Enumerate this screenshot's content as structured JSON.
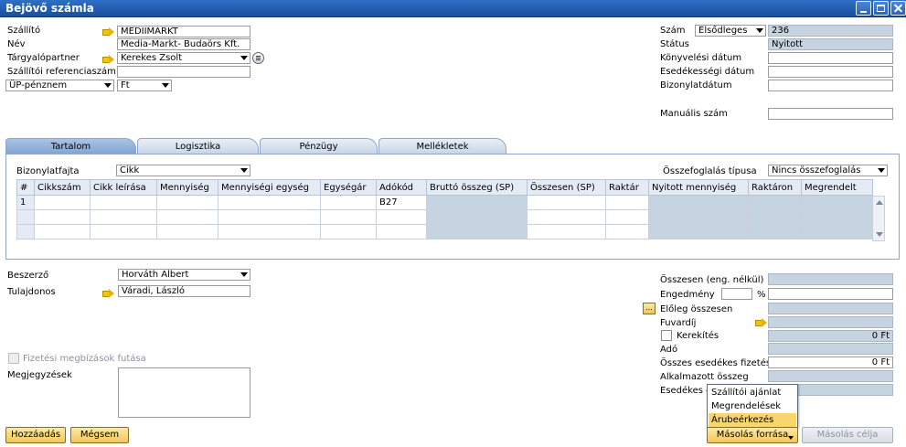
{
  "window": {
    "title": "Bejövő számla"
  },
  "header_left": {
    "supplier_label": "Szállító",
    "supplier_value": "MEDIIMARKT",
    "name_label": "Név",
    "name_value": "Media-Markt- Budaörs Kft.",
    "contact_label": "Tárgyalópartner",
    "contact_value": "Kerekes Zsolt",
    "ref_label": "Szállítói referenciaszám",
    "ref_value": "",
    "currency_type": "ÜP-pénznem",
    "currency": "Ft"
  },
  "header_right": {
    "number_label": "Szám",
    "series": "Elsődleges",
    "number_value": "236",
    "status_label": "Státus",
    "status_value": "Nyitott",
    "posting_label": "Könyvelési dátum",
    "due_label": "Esedékességi dátum",
    "doc_date_label": "Bizonylatdátum",
    "manual_label": "Manuális szám"
  },
  "tabs": [
    "Tartalom",
    "Logisztika",
    "Pénzügy",
    "Mellékletek"
  ],
  "content": {
    "doc_type_label": "Bizonylatfajta",
    "doc_type_value": "Cikk",
    "summary_label": "Összefoglalás típusa",
    "summary_value": "Nincs összefoglalás",
    "columns": [
      "#",
      "Cikkszám",
      "Cikk leírása",
      "Mennyiség",
      "Mennyiségi egység",
      "Egységár",
      "Adókód",
      "Bruttó összeg (SP)",
      "Összesen (SP)",
      "Raktár",
      "Nyitott mennyiség",
      "Raktáron",
      "Megrendelt"
    ],
    "rows": [
      [
        "1",
        "",
        "",
        "",
        "",
        "",
        "B27",
        "",
        "",
        "",
        "",
        "",
        ""
      ],
      [
        "",
        "",
        "",
        "",
        "",
        "",
        "",
        "",
        "",
        "",
        "",
        "",
        ""
      ],
      [
        "",
        "",
        "",
        "",
        "",
        "",
        "",
        "",
        "",
        "",
        "",
        "",
        ""
      ]
    ]
  },
  "footer_left": {
    "buyer_label": "Beszerző",
    "buyer_value": "Horváth Albert",
    "owner_label": "Tulajdonos",
    "owner_value": "Váradi, László",
    "payment_run_label": "Fizetési megbízások futása",
    "remarks_label": "Megjegyzések"
  },
  "totals": {
    "total_before_disc_label": "Összesen (eng. nélkül)",
    "discount_label": "Engedmény",
    "percent_sign": "%",
    "dp_total_label": "Előleg összesen",
    "dots": "...",
    "freight_label": "Fuvardíj",
    "rounding_label": "Kerekítés",
    "rounding_value": "0 Ft",
    "tax_label": "Adó",
    "total_due_label": "Összes esedékes fizetés",
    "total_due_value": "0 Ft",
    "applied_label": "Alkalmazott összeg",
    "balance_label": "Esedékes e"
  },
  "buttons": {
    "add": "Hozzáadás",
    "cancel": "Mégsem",
    "copy_from": "Másolás forrása",
    "copy_to": "Másolás célja"
  },
  "copy_menu": [
    "Szállítói ajánlat",
    "Megrendelések",
    "Árubeérkezés"
  ]
}
